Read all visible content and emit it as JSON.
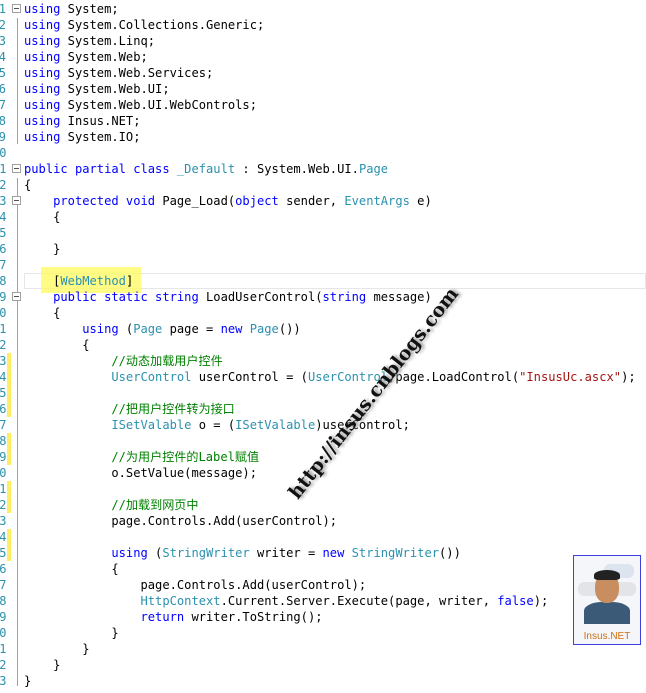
{
  "editor": {
    "colors": {
      "keyword": "#0000ff",
      "type": "#2b91af",
      "comment": "#008000",
      "string": "#a31515",
      "line_number": "#2b91af",
      "change_marker": "#ffee62",
      "highlight": "#fffb5e"
    },
    "lines": [
      [
        [
          "kw",
          "using"
        ],
        [
          "pl",
          " System;"
        ]
      ],
      [
        [
          "kw",
          "using"
        ],
        [
          "pl",
          " System.Collections.Generic;"
        ]
      ],
      [
        [
          "kw",
          "using"
        ],
        [
          "pl",
          " System.Linq;"
        ]
      ],
      [
        [
          "kw",
          "using"
        ],
        [
          "pl",
          " System.Web;"
        ]
      ],
      [
        [
          "kw",
          "using"
        ],
        [
          "pl",
          " System.Web.Services;"
        ]
      ],
      [
        [
          "kw",
          "using"
        ],
        [
          "pl",
          " System.Web.UI;"
        ]
      ],
      [
        [
          "kw",
          "using"
        ],
        [
          "pl",
          " System.Web.UI.WebControls;"
        ]
      ],
      [
        [
          "kw",
          "using"
        ],
        [
          "pl",
          " Insus.NET;"
        ]
      ],
      [
        [
          "kw",
          "using"
        ],
        [
          "pl",
          " System.IO;"
        ]
      ],
      [],
      [
        [
          "kw",
          "public partial class"
        ],
        [
          "pl",
          " "
        ],
        [
          "ty",
          "_Default"
        ],
        [
          "pl",
          " : System.Web.UI."
        ],
        [
          "ty",
          "Page"
        ]
      ],
      [
        [
          "pl",
          "{"
        ]
      ],
      [
        [
          "pl",
          "    "
        ],
        [
          "kw",
          "protected void"
        ],
        [
          "pl",
          " Page_Load("
        ],
        [
          "kw",
          "object"
        ],
        [
          "pl",
          " sender, "
        ],
        [
          "ty",
          "EventArgs"
        ],
        [
          "pl",
          " e)"
        ]
      ],
      [
        [
          "pl",
          "    {"
        ]
      ],
      [],
      [
        [
          "pl",
          "    }"
        ]
      ],
      [],
      [
        [
          "pl",
          "    ["
        ],
        [
          "ty",
          "WebMethod"
        ],
        [
          "pl",
          "]"
        ]
      ],
      [
        [
          "pl",
          "    "
        ],
        [
          "kw",
          "public static string"
        ],
        [
          "pl",
          " LoadUserControl("
        ],
        [
          "kw",
          "string"
        ],
        [
          "pl",
          " message)"
        ]
      ],
      [
        [
          "pl",
          "    {"
        ]
      ],
      [
        [
          "pl",
          "        "
        ],
        [
          "kw",
          "using"
        ],
        [
          "pl",
          " ("
        ],
        [
          "ty",
          "Page"
        ],
        [
          "pl",
          " page = "
        ],
        [
          "kw",
          "new"
        ],
        [
          "pl",
          " "
        ],
        [
          "ty",
          "Page"
        ],
        [
          "pl",
          "())"
        ]
      ],
      [
        [
          "pl",
          "        {"
        ]
      ],
      [
        [
          "pl",
          "            "
        ],
        [
          "cm",
          "//动态加载用户控件"
        ]
      ],
      [
        [
          "pl",
          "            "
        ],
        [
          "ty",
          "UserControl"
        ],
        [
          "pl",
          " userControl = ("
        ],
        [
          "ty",
          "UserControl"
        ],
        [
          "pl",
          ")page.LoadControl("
        ],
        [
          "st",
          "\"InsusUc.ascx\""
        ],
        [
          "pl",
          ");"
        ]
      ],
      [],
      [
        [
          "pl",
          "            "
        ],
        [
          "cm",
          "//把用户控件转为接口"
        ]
      ],
      [
        [
          "pl",
          "            "
        ],
        [
          "ty",
          "ISetValable"
        ],
        [
          "pl",
          " o = ("
        ],
        [
          "ty",
          "ISetValable"
        ],
        [
          "pl",
          ")userControl;"
        ]
      ],
      [],
      [
        [
          "pl",
          "            "
        ],
        [
          "cm",
          "//为用户控件的Label赋值"
        ]
      ],
      [
        [
          "pl",
          "            o.SetValue(message);"
        ]
      ],
      [],
      [
        [
          "pl",
          "            "
        ],
        [
          "cm",
          "//加载到网页中"
        ]
      ],
      [
        [
          "pl",
          "            page.Controls.Add(userControl);"
        ]
      ],
      [],
      [
        [
          "pl",
          "            "
        ],
        [
          "kw",
          "using"
        ],
        [
          "pl",
          " ("
        ],
        [
          "ty",
          "StringWriter"
        ],
        [
          "pl",
          " writer = "
        ],
        [
          "kw",
          "new"
        ],
        [
          "pl",
          " "
        ],
        [
          "ty",
          "StringWriter"
        ],
        [
          "pl",
          "())"
        ]
      ],
      [
        [
          "pl",
          "            {"
        ]
      ],
      [
        [
          "pl",
          "                page.Controls.Add(userControl);"
        ]
      ],
      [
        [
          "pl",
          "                "
        ],
        [
          "ty",
          "HttpContext"
        ],
        [
          "pl",
          ".Current.Server.Execute(page, writer, "
        ],
        [
          "kw",
          "false"
        ],
        [
          "pl",
          ");"
        ]
      ],
      [
        [
          "pl",
          "                "
        ],
        [
          "kw",
          "return"
        ],
        [
          "pl",
          " writer.ToString();"
        ]
      ],
      [
        [
          "pl",
          "            }"
        ]
      ],
      [
        [
          "pl",
          "        }"
        ]
      ],
      [
        [
          "pl",
          "    }"
        ]
      ],
      [
        [
          "pl",
          "}"
        ]
      ]
    ],
    "changed_lines": [
      23,
      24,
      25,
      26,
      28,
      29,
      31,
      32,
      34,
      35
    ],
    "fold_lines": [
      1,
      11,
      13,
      19
    ]
  },
  "watermark": "http://insus.cnblogs.com",
  "avatar": {
    "caption": "Insus.NET"
  }
}
